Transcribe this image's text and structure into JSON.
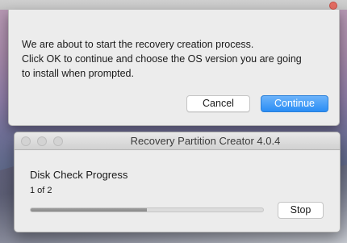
{
  "alert": {
    "message_lines": [
      "We are about to start the recovery creation process.",
      "Click OK to continue and choose the OS version you are going",
      "to install when prompted."
    ],
    "cancel_label": "Cancel",
    "continue_label": "Continue"
  },
  "progress_window": {
    "title": "Recovery Partition Creator 4.0.4",
    "task_title": "Disk Check Progress",
    "step_text": "1 of 2",
    "progress_fraction": 0.5,
    "stop_label": "Stop"
  },
  "colors": {
    "accent": "#2a8df5",
    "close_button": "#e36c62"
  }
}
